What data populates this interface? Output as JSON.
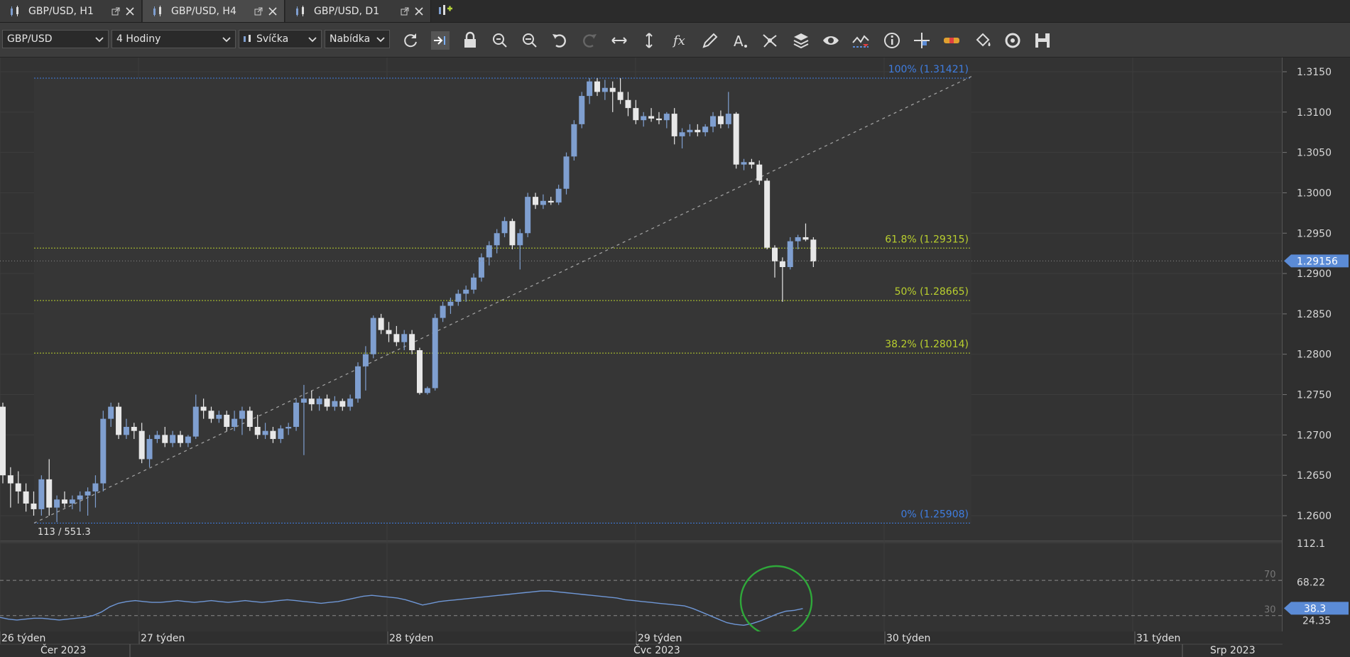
{
  "tabs": [
    {
      "label": "GBP/USD, H1",
      "active": false
    },
    {
      "label": "GBP/USD, H4",
      "active": true
    },
    {
      "label": "GBP/USD, D1",
      "active": false
    }
  ],
  "toolbar": {
    "symbol": "GBP/USD",
    "timeframe": "4 Hodiny",
    "chart_type": "Svíčka",
    "price_side": "Nabídka",
    "tools": [
      "refresh-icon",
      "autoscroll-icon",
      "lock-icon",
      "zoom-in-icon",
      "zoom-out-icon",
      "undo-icon",
      "redo-icon",
      "horizontal-resize-icon",
      "vertical-resize-icon",
      "indicator-fx-icon",
      "pencil-icon",
      "text-icon",
      "pattern-icon",
      "layers-icon",
      "eye-icon",
      "drawings-icon",
      "info-icon",
      "crosshair-icon",
      "alerts-icon",
      "paint-bucket-icon",
      "restore-icon",
      "save-icon"
    ]
  },
  "price_axis": {
    "ticks": [
      "1.3150",
      "1.3100",
      "1.3050",
      "1.3000",
      "1.2950",
      "1.2900",
      "1.2850",
      "1.2800",
      "1.2750",
      "1.2700",
      "1.2650",
      "1.2600"
    ],
    "current_price": "1.29156"
  },
  "fibonacci": [
    {
      "label": "100% (1.31421)",
      "color": "#3f7de0"
    },
    {
      "label": "61.8% (1.29315)",
      "color": "#b9cf2e"
    },
    {
      "label": "50% (1.28665)",
      "color": "#b9cf2e"
    },
    {
      "label": "38.2% (1.28014)",
      "color": "#b9cf2e"
    },
    {
      "label": "0% (1.25908)",
      "color": "#3f7de0"
    }
  ],
  "info_readout": "113 / 551.3",
  "oscillator": {
    "axis_ticks": [
      "112.1",
      "68.22"
    ],
    "axis_partial": "24.35",
    "level_70": "70",
    "level_30": "30",
    "current_value": "38.3"
  },
  "time_axis": {
    "weeks": [
      "26 týden",
      "27 týden",
      "28 týden",
      "29 týden",
      "30 týden",
      "31 týden"
    ],
    "months": [
      "Čer 2023",
      "Čvc 2023",
      "Srp 2023"
    ]
  },
  "chart_data": {
    "type": "candlestick",
    "symbol": "GBP/USD",
    "timeframe": "H4",
    "ylim": [
      1.2575,
      1.3175
    ],
    "candles": [
      [
        1.2735,
        1.274,
        1.264,
        1.265
      ],
      [
        1.265,
        1.266,
        1.261,
        1.264
      ],
      [
        1.264,
        1.2655,
        1.2615,
        1.263
      ],
      [
        1.263,
        1.264,
        1.2605,
        1.2615
      ],
      [
        1.2615,
        1.263,
        1.26,
        1.2608
      ],
      [
        1.2608,
        1.265,
        1.26,
        1.2645
      ],
      [
        1.2645,
        1.267,
        1.26,
        1.261
      ],
      [
        1.261,
        1.2625,
        1.2592,
        1.262
      ],
      [
        1.262,
        1.263,
        1.261,
        1.2615
      ],
      [
        1.2615,
        1.2625,
        1.2608,
        1.262
      ],
      [
        1.262,
        1.263,
        1.2605,
        1.2625
      ],
      [
        1.2625,
        1.2635,
        1.26,
        1.263
      ],
      [
        1.263,
        1.265,
        1.261,
        1.264
      ],
      [
        1.264,
        1.273,
        1.263,
        1.272
      ],
      [
        1.272,
        1.274,
        1.271,
        1.2735
      ],
      [
        1.2735,
        1.274,
        1.2695,
        1.27
      ],
      [
        1.27,
        1.272,
        1.2695,
        1.271
      ],
      [
        1.271,
        1.2715,
        1.2695,
        1.2705
      ],
      [
        1.2705,
        1.2715,
        1.2665,
        1.267
      ],
      [
        1.267,
        1.27,
        1.266,
        1.2695
      ],
      [
        1.2695,
        1.2705,
        1.269,
        1.27
      ],
      [
        1.27,
        1.271,
        1.2685,
        1.269
      ],
      [
        1.269,
        1.2705,
        1.2685,
        1.27
      ],
      [
        1.27,
        1.2705,
        1.2685,
        1.269
      ],
      [
        1.269,
        1.27,
        1.2685,
        1.2698
      ],
      [
        1.2698,
        1.275,
        1.2695,
        1.2735
      ],
      [
        1.2735,
        1.2745,
        1.272,
        1.273
      ],
      [
        1.273,
        1.2735,
        1.2715,
        1.272
      ],
      [
        1.272,
        1.273,
        1.2715,
        1.2725
      ],
      [
        1.2725,
        1.273,
        1.2705,
        1.271
      ],
      [
        1.271,
        1.273,
        1.2705,
        1.272
      ],
      [
        1.272,
        1.2735,
        1.27,
        1.273
      ],
      [
        1.273,
        1.2735,
        1.2705,
        1.271
      ],
      [
        1.271,
        1.2725,
        1.2695,
        1.27
      ],
      [
        1.27,
        1.2715,
        1.2695,
        1.2705
      ],
      [
        1.2705,
        1.271,
        1.269,
        1.2695
      ],
      [
        1.2695,
        1.2712,
        1.269,
        1.2708
      ],
      [
        1.2708,
        1.2715,
        1.27,
        1.271
      ],
      [
        1.271,
        1.2745,
        1.2705,
        1.274
      ],
      [
        1.274,
        1.2762,
        1.2675,
        1.2745
      ],
      [
        1.2745,
        1.2755,
        1.273,
        1.2738
      ],
      [
        1.2738,
        1.2748,
        1.273,
        1.2745
      ],
      [
        1.2745,
        1.275,
        1.273,
        1.2735
      ],
      [
        1.2735,
        1.2748,
        1.273,
        1.2742
      ],
      [
        1.2742,
        1.2745,
        1.273,
        1.2735
      ],
      [
        1.2735,
        1.275,
        1.273,
        1.2745
      ],
      [
        1.2745,
        1.279,
        1.274,
        1.2785
      ],
      [
        1.2785,
        1.281,
        1.2755,
        1.28
      ],
      [
        1.28,
        1.2848,
        1.2795,
        1.2845
      ],
      [
        1.2845,
        1.285,
        1.2825,
        1.283
      ],
      [
        1.283,
        1.284,
        1.2815,
        1.2825
      ],
      [
        1.2825,
        1.2835,
        1.281,
        1.2815
      ],
      [
        1.2815,
        1.283,
        1.2805,
        1.2825
      ],
      [
        1.2825,
        1.283,
        1.28,
        1.2805
      ],
      [
        1.2805,
        1.2808,
        1.275,
        1.2752
      ],
      [
        1.2752,
        1.276,
        1.275,
        1.2758
      ],
      [
        1.2758,
        1.285,
        1.2755,
        1.2845
      ],
      [
        1.2845,
        1.2865,
        1.284,
        1.286
      ],
      [
        1.286,
        1.287,
        1.285,
        1.2865
      ],
      [
        1.2865,
        1.288,
        1.286,
        1.2875
      ],
      [
        1.2875,
        1.2885,
        1.2865,
        1.288
      ],
      [
        1.288,
        1.29,
        1.2875,
        1.2895
      ],
      [
        1.2895,
        1.2925,
        1.289,
        1.292
      ],
      [
        1.292,
        1.294,
        1.291,
        1.2935
      ],
      [
        1.2935,
        1.2955,
        1.2925,
        1.295
      ],
      [
        1.295,
        1.297,
        1.2945,
        1.2965
      ],
      [
        1.2965,
        1.2968,
        1.293,
        1.2935
      ],
      [
        1.2935,
        1.2955,
        1.2905,
        1.295
      ],
      [
        1.295,
        1.3,
        1.2945,
        1.2995
      ],
      [
        1.2995,
        1.3,
        1.298,
        1.2985
      ],
      [
        1.2985,
        1.2998,
        1.298,
        1.299
      ],
      [
        1.299,
        1.2995,
        1.2985,
        1.2988
      ],
      [
        1.2988,
        1.301,
        1.2985,
        1.3005
      ],
      [
        1.3005,
        1.305,
        1.2998,
        1.3045
      ],
      [
        1.3045,
        1.309,
        1.304,
        1.3085
      ],
      [
        1.3085,
        1.3125,
        1.308,
        1.312
      ],
      [
        1.312,
        1.3142,
        1.311,
        1.3138
      ],
      [
        1.3138,
        1.3142,
        1.312,
        1.3125
      ],
      [
        1.3125,
        1.314,
        1.3115,
        1.313
      ],
      [
        1.313,
        1.3138,
        1.31,
        1.3125
      ],
      [
        1.3125,
        1.3142,
        1.311,
        1.3115
      ],
      [
        1.3115,
        1.3125,
        1.3095,
        1.3105
      ],
      [
        1.3105,
        1.3115,
        1.3085,
        1.309
      ],
      [
        1.309,
        1.31,
        1.3082,
        1.3095
      ],
      [
        1.3095,
        1.3105,
        1.3088,
        1.3092
      ],
      [
        1.3092,
        1.31,
        1.3085,
        1.309
      ],
      [
        1.309,
        1.31,
        1.308,
        1.3098
      ],
      [
        1.3098,
        1.3105,
        1.306,
        1.307
      ],
      [
        1.307,
        1.308,
        1.3055,
        1.3075
      ],
      [
        1.3075,
        1.3085,
        1.307,
        1.3078
      ],
      [
        1.3078,
        1.3085,
        1.307,
        1.3075
      ],
      [
        1.3075,
        1.3085,
        1.307,
        1.3082
      ],
      [
        1.3082,
        1.31,
        1.3075,
        1.3095
      ],
      [
        1.3095,
        1.3102,
        1.308,
        1.3085
      ],
      [
        1.3085,
        1.3125,
        1.308,
        1.3098
      ],
      [
        1.3098,
        1.31,
        1.303,
        1.3035
      ],
      [
        1.3035,
        1.3042,
        1.3028,
        1.3038
      ],
      [
        1.3038,
        1.3042,
        1.303,
        1.3035
      ],
      [
        1.3035,
        1.304,
        1.301,
        1.3015
      ],
      [
        1.3015,
        1.3018,
        1.293,
        1.2932
      ],
      [
        1.2932,
        1.2935,
        1.2895,
        1.2915
      ],
      [
        1.2915,
        1.292,
        1.2865,
        1.2908
      ],
      [
        1.2908,
        1.2945,
        1.2905,
        1.294
      ],
      [
        1.294,
        1.2948,
        1.293,
        1.2945
      ],
      [
        1.2945,
        1.2962,
        1.294,
        1.2942
      ],
      [
        1.2942,
        1.2945,
        1.2908,
        1.2915
      ]
    ],
    "oscillator_values": [
      28,
      26,
      25,
      26,
      27,
      27,
      26,
      25,
      26,
      27,
      28,
      30,
      34,
      40,
      44,
      46,
      47,
      46,
      45,
      45,
      46,
      47,
      46,
      45,
      46,
      47,
      46,
      45,
      46,
      47,
      46,
      45,
      46,
      47,
      48,
      47,
      46,
      45,
      44,
      45,
      46,
      48,
      50,
      52,
      53,
      52,
      51,
      50,
      48,
      45,
      42,
      44,
      46,
      47,
      48,
      49,
      50,
      51,
      52,
      53,
      54,
      55,
      56,
      57,
      58,
      58,
      57,
      56,
      55,
      54,
      53,
      52,
      51,
      50,
      48,
      47,
      46,
      45,
      44,
      43,
      42,
      41,
      38,
      34,
      30,
      26,
      22,
      20,
      19,
      21,
      24,
      28,
      32,
      35,
      36,
      38
    ],
    "oscillator_ylim": [
      12,
      112.1
    ],
    "levels": [
      70,
      30
    ],
    "fibonacci_levels": [
      {
        "ratio": "100%",
        "price": 1.31421
      },
      {
        "ratio": "61.8%",
        "price": 1.29315
      },
      {
        "ratio": "50%",
        "price": 1.28665
      },
      {
        "ratio": "38.2%",
        "price": 1.28014
      },
      {
        "ratio": "0%",
        "price": 1.25908
      }
    ]
  }
}
